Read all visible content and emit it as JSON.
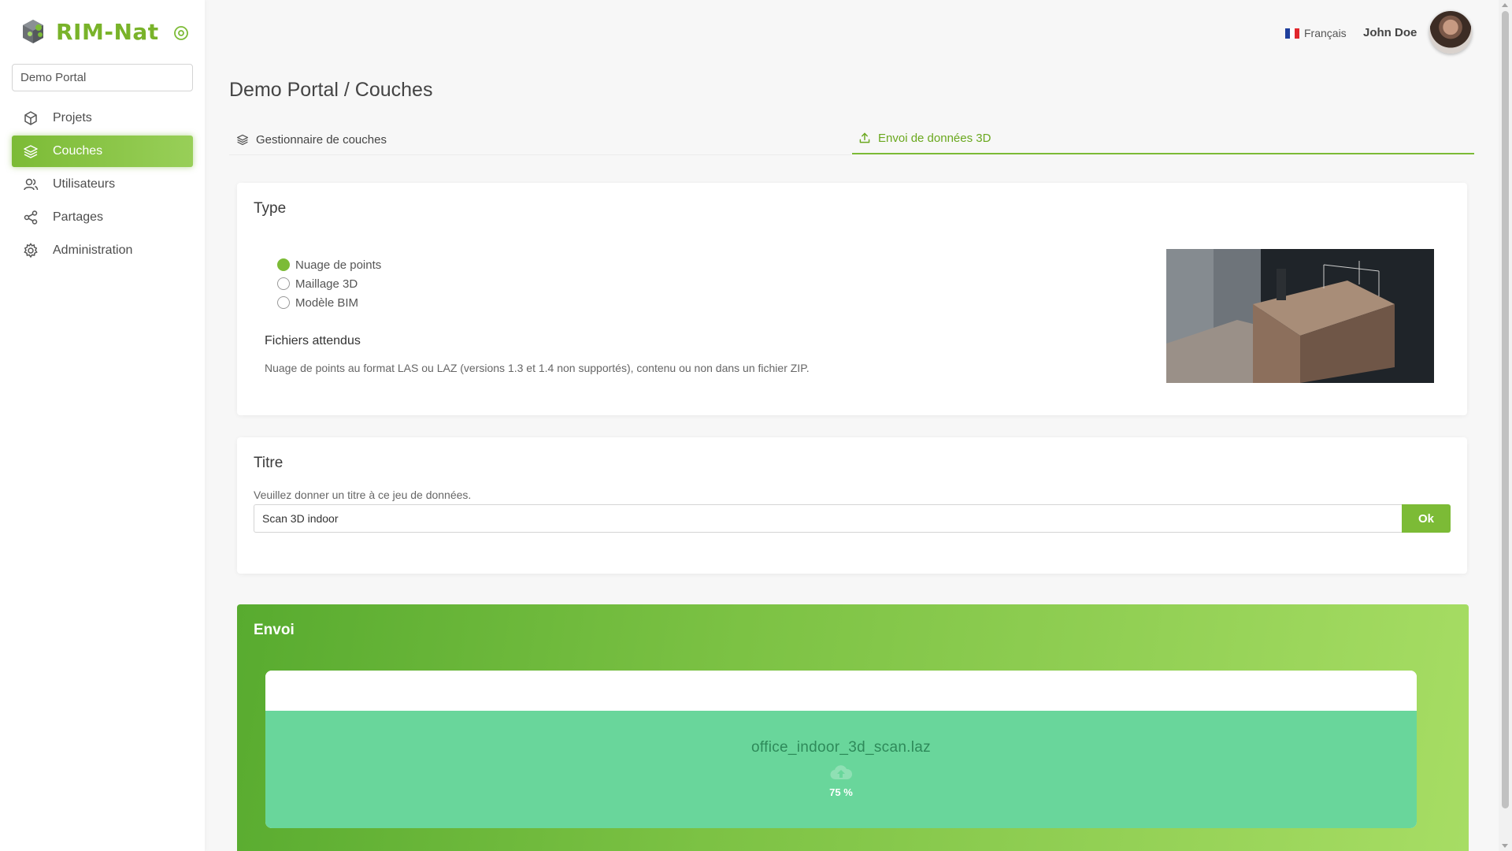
{
  "brand": {
    "name": "RIM-Nat",
    "accent": "#7cbb36"
  },
  "sidebar": {
    "portal": "Demo Portal",
    "items": [
      {
        "label": "Projets",
        "icon": "cube-icon",
        "active": false
      },
      {
        "label": "Couches",
        "icon": "layers-icon",
        "active": true
      },
      {
        "label": "Utilisateurs",
        "icon": "users-icon",
        "active": false
      },
      {
        "label": "Partages",
        "icon": "share-icon",
        "active": false
      },
      {
        "label": "Administration",
        "icon": "gear-icon",
        "active": false
      }
    ]
  },
  "header": {
    "language": "Français",
    "user": "John Doe"
  },
  "page": {
    "title": "Demo Portal / Couches",
    "tabs": [
      {
        "label": "Gestionnaire de couches",
        "icon": "layers-icon",
        "active": false
      },
      {
        "label": "Envoi de données 3D",
        "icon": "upload-icon",
        "active": true
      }
    ]
  },
  "type_card": {
    "title": "Type",
    "options": [
      {
        "label": "Nuage de points",
        "checked": true
      },
      {
        "label": "Maillage 3D",
        "checked": false
      },
      {
        "label": "Modèle BIM",
        "checked": false
      }
    ],
    "files_title": "Fichiers attendus",
    "files_desc": "Nuage de points au format LAS ou LAZ (versions 1.3 et 1.4 non supportés), contenu ou non dans un fichier ZIP."
  },
  "title_card": {
    "title": "Titre",
    "hint": "Veuillez donner un titre à ce jeu de données.",
    "value": "Scan 3D indoor",
    "ok_label": "Ok"
  },
  "upload_card": {
    "title": "Envoi",
    "file_name": "office_indoor_3d_scan.laz",
    "progress_label": "75 %",
    "progress": 0.75
  }
}
